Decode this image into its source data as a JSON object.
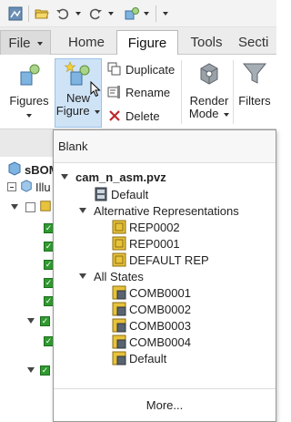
{
  "tabs": {
    "file": "File",
    "home": "Home",
    "figure": "Figure",
    "tools": "Tools",
    "section": "Secti"
  },
  "ribbon": {
    "figures": "Figures",
    "new_figure_line1": "New",
    "new_figure_line2": "Figure",
    "duplicate": "Duplicate",
    "rename": "Rename",
    "delete": "Delete",
    "render_mode_line1": "Render",
    "render_mode_line2": "Mode",
    "filters": "Filters"
  },
  "tree": {
    "root_label": "sBOM",
    "child_label": "Illu"
  },
  "dropdown": {
    "blank": "Blank",
    "file": "cam_n_asm.pvz",
    "default_top": "Default",
    "alt_reps_header": "Alternative Representations",
    "alt_reps": [
      "REP0002",
      "REP0001",
      "DEFAULT REP"
    ],
    "states_header": "All States",
    "states": [
      "COMB0001",
      "COMB0002",
      "COMB0003",
      "COMB0004",
      "Default"
    ],
    "more": "More..."
  },
  "colors": {
    "accent_highlight": "#cfe3f6",
    "check_green": "#2f9a2f",
    "rep_icon_yellow": "#e8c23a",
    "state_icon_gray": "#5a6470"
  }
}
